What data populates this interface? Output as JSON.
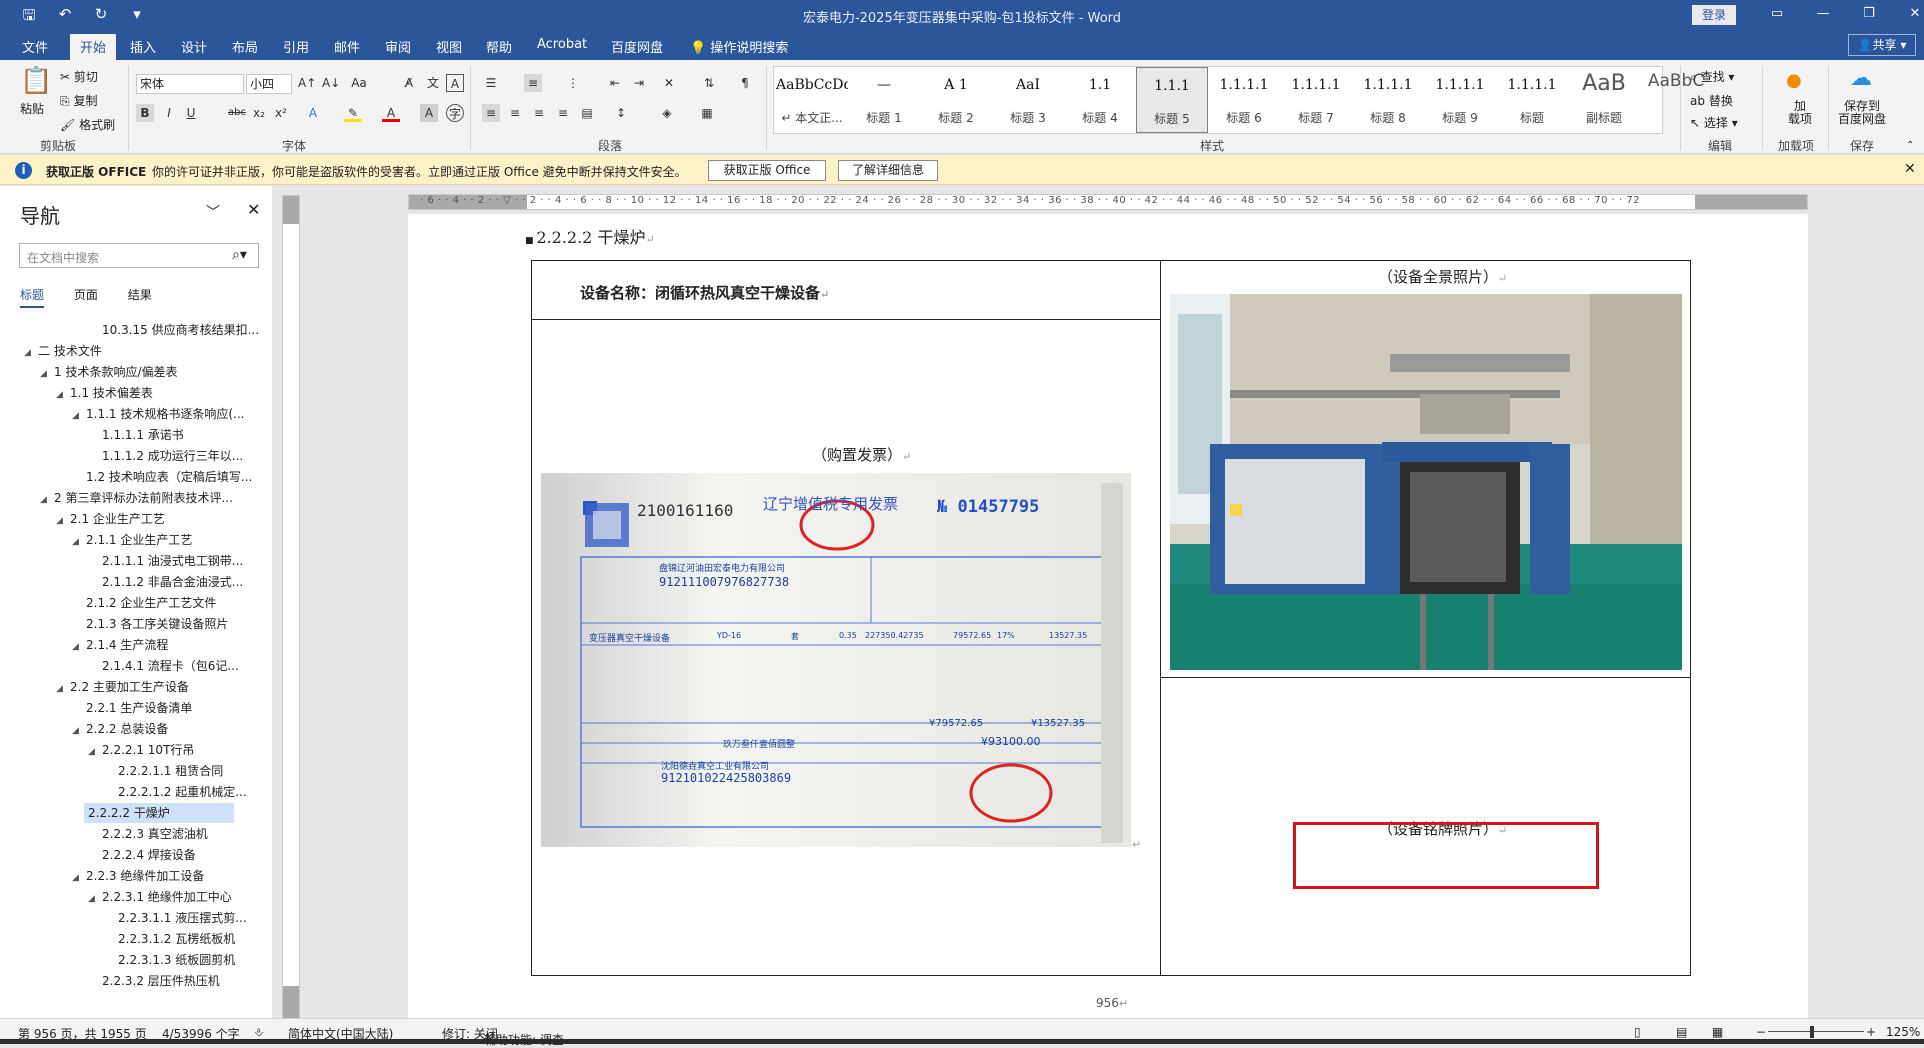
{
  "titlebar": {
    "title": "宏泰电力-2025年变压器集中采购-包1投标文件  -  Word",
    "login": "登录"
  },
  "tabs": [
    "文件",
    "开始",
    "插入",
    "设计",
    "布局",
    "引用",
    "邮件",
    "审阅",
    "视图",
    "帮助",
    "Acrobat",
    "百度网盘"
  ],
  "tell_me": "操作说明搜索",
  "share": "共享",
  "ribbon": {
    "clipboard": {
      "paste": "粘贴",
      "cut": "剪切",
      "copy": "复制",
      "format_painter": "格式刷",
      "label": "剪贴板"
    },
    "font": {
      "name": "宋体",
      "size": "小四",
      "label": "字体"
    },
    "paragraph": {
      "label": "段落"
    },
    "styles": {
      "label": "样式",
      "items": [
        {
          "preview": "AaBbCcDdI",
          "name": "↵ 本文正..."
        },
        {
          "preview": "—",
          "name": "标题 1"
        },
        {
          "preview": "A 1",
          "name": "标题 2"
        },
        {
          "preview": "AaI",
          "name": "标题 3"
        },
        {
          "preview": "1.1",
          "name": "标题 4"
        },
        {
          "preview": "1.1.1",
          "name": "标题 5"
        },
        {
          "preview": "1.1.1.1",
          "name": "标题 6"
        },
        {
          "preview": "1.1.1.1",
          "name": "标题 7"
        },
        {
          "preview": "1.1.1.1",
          "name": "标题 8"
        },
        {
          "preview": "1.1.1.1",
          "name": "标题 9"
        },
        {
          "preview": "1.1.1.1",
          "name": "标题"
        },
        {
          "preview": "AaB",
          "name": "副标题"
        },
        {
          "preview": "AaBbC",
          "name": ""
        }
      ]
    },
    "editing": {
      "find": "查找",
      "replace": "替换",
      "select": "选择",
      "label": "编辑"
    },
    "addins": {
      "add": "加\n载项",
      "label": "加载项"
    },
    "save": {
      "baidu": "保存到\n百度网盘",
      "label": "保存"
    }
  },
  "warning": {
    "bold": "获取正版 OFFICE",
    "text": "你的许可证并非正版，你可能是盗版软件的受害者。立即通过正版 Office 避免中断并保持文件安全。",
    "btn1": "获取正版 Office",
    "btn2": "了解详细信息"
  },
  "nav": {
    "title": "导航",
    "search_placeholder": "在文档中搜索",
    "tabs": [
      "标题",
      "页面",
      "结果"
    ],
    "items": [
      {
        "level": 4,
        "text": "10.3.15 供应商考核结果扣...",
        "arrow": ""
      },
      {
        "level": 0,
        "text": "二 技术文件",
        "arrow": "◢"
      },
      {
        "level": 1,
        "text": "1 技术条款响应/偏差表",
        "arrow": "◢"
      },
      {
        "level": 2,
        "text": "1.1 技术偏差表",
        "arrow": "◢"
      },
      {
        "level": 3,
        "text": "1.1.1 技术规格书逐条响应(...",
        "arrow": "◢"
      },
      {
        "level": 4,
        "text": "1.1.1.1 承诺书",
        "arrow": ""
      },
      {
        "level": 4,
        "text": "1.1.1.2 成功运行三年以...",
        "arrow": ""
      },
      {
        "level": 3,
        "text": "1.2 技术响应表（定稿后填写...",
        "arrow": ""
      },
      {
        "level": 1,
        "text": "2 第三章评标办法前附表技术评...",
        "arrow": "◢"
      },
      {
        "level": 2,
        "text": "2.1 企业生产工艺",
        "arrow": "◢"
      },
      {
        "level": 3,
        "text": "2.1.1 企业生产工艺",
        "arrow": "◢"
      },
      {
        "level": 4,
        "text": "2.1.1.1 油浸式电工钢带...",
        "arrow": ""
      },
      {
        "level": 4,
        "text": "2.1.1.2 非晶合金油浸式...",
        "arrow": ""
      },
      {
        "level": 3,
        "text": "2.1.2 企业生产工艺文件",
        "arrow": ""
      },
      {
        "level": 3,
        "text": "2.1.3 各工序关键设备照片",
        "arrow": ""
      },
      {
        "level": 3,
        "text": "2.1.4 生产流程",
        "arrow": "◢"
      },
      {
        "level": 4,
        "text": "2.1.4.1 流程卡（包6记...",
        "arrow": ""
      },
      {
        "level": 2,
        "text": "2.2 主要加工生产设备",
        "arrow": "◢"
      },
      {
        "level": 3,
        "text": "2.2.1 生产设备清单",
        "arrow": ""
      },
      {
        "level": 3,
        "text": "2.2.2 总装设备",
        "arrow": "◢"
      },
      {
        "level": 4,
        "text": "2.2.2.1 10T行吊",
        "arrow": "◢"
      },
      {
        "level": 5,
        "text": "2.2.2.1.1 租赁合同",
        "arrow": ""
      },
      {
        "level": 5,
        "text": "2.2.2.1.2 起重机械定...",
        "arrow": ""
      },
      {
        "level": 4,
        "text": "2.2.2.2 干燥炉",
        "arrow": "",
        "active": true
      },
      {
        "level": 4,
        "text": "2.2.2.3 真空滤油机",
        "arrow": ""
      },
      {
        "level": 4,
        "text": "2.2.2.4 焊接设备",
        "arrow": ""
      },
      {
        "level": 3,
        "text": "2.2.3 绝缘件加工设备",
        "arrow": "◢"
      },
      {
        "level": 4,
        "text": "2.2.3.1 绝缘件加工中心",
        "arrow": "◢"
      },
      {
        "level": 5,
        "text": "2.2.3.1.1 液压摆式剪...",
        "arrow": ""
      },
      {
        "level": 5,
        "text": "2.2.3.1.2 瓦楞纸板机",
        "arrow": ""
      },
      {
        "level": 5,
        "text": "2.2.3.1.3 纸板圆剪机",
        "arrow": ""
      },
      {
        "level": 4,
        "text": "2.2.3.2 层压件热压机",
        "arrow": ""
      }
    ]
  },
  "document": {
    "heading": "2.2.2.2 干燥炉",
    "equipment_name": "设备名称：闭循环热风真空干燥设备",
    "panorama_caption": "（设备全景照片）",
    "invoice_caption": "（购置发票）",
    "nameplate_caption": "（设备铭牌照片）",
    "page_number": "956",
    "invoice": {
      "code": "2100161160",
      "title": "辽宁增值税专用发票",
      "no_label": "№",
      "no": "01457795",
      "buyer": "盘锦辽河油田宏泰电力有限公司",
      "buyer_tax": "912111007976827738",
      "item": "变压器真空干燥设备",
      "model": "YD-16",
      "unit": "套",
      "qty": "0.35",
      "price": "227350.42735",
      "amount": "79572.65",
      "tax_rate": "17%",
      "tax": "13527.35",
      "total_amt": "¥79572.65",
      "total_tax": "¥13527.35",
      "grand_words": "玖万叁仟壹佰圆整",
      "grand": "¥93100.00",
      "seller": "沈阳德垚真空工业有限公司",
      "seller_tax": "912101022425803869"
    }
  },
  "status": {
    "page": "第 956 页，共 1955 页",
    "words": "4/53996 个字",
    "lang": "简体中文(中国大陆)",
    "track": "修订: 关闭",
    "access": "辅助功能: 调查",
    "zoom": "125%"
  },
  "colors": {
    "accent": "#2b579a",
    "warning_bg": "#fdf1c8",
    "highlight": "#d0161b"
  }
}
